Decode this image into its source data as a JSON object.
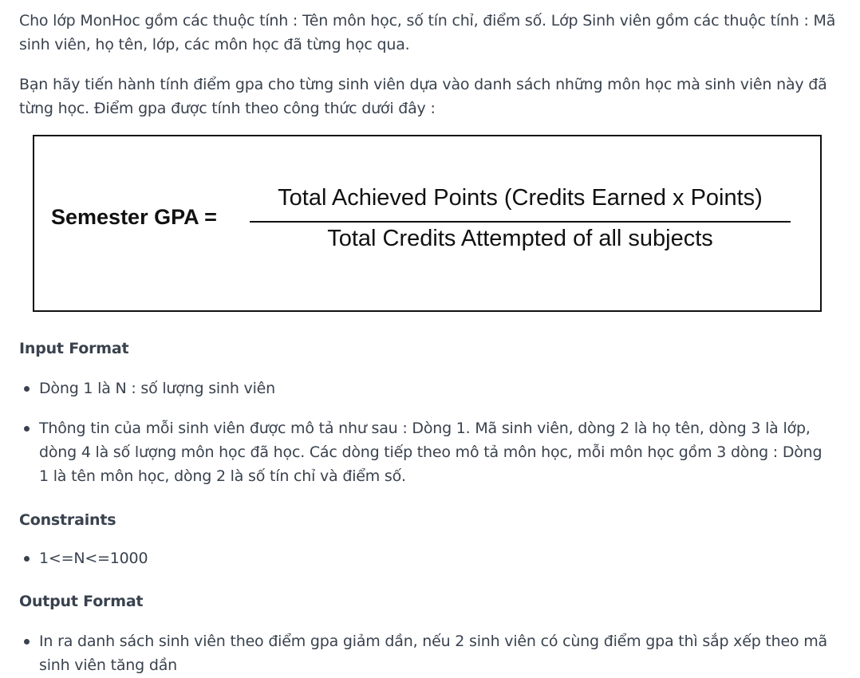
{
  "intro": {
    "paragraph1": "Cho lớp MonHoc gồm các thuộc tính : Tên môn học, số tín chỉ, điểm số. Lớp Sinh viên gồm các thuộc tính : Mã sinh viên, họ tên, lớp, các môn học đã từng học qua.",
    "paragraph2": "Bạn hãy tiến hành tính điểm gpa cho từng sinh viên dựa vào danh sách những môn học mà sinh viên này đã từng học. Điểm gpa được tính theo công thức dưới đây :"
  },
  "formula": {
    "lhs": "Semester GPA =",
    "numerator": "Total Achieved Points (Credits Earned x Points)",
    "denominator": "Total Credits Attempted of all subjects"
  },
  "input_format": {
    "heading": "Input Format",
    "items": [
      "Dòng 1 là N : số lượng sinh viên",
      "Thông tin của mỗi sinh viên được mô tả như sau : Dòng 1. Mã sinh viên, dòng 2 là họ tên, dòng 3 là lớp, dòng 4 là số lượng môn học đã học. Các dòng tiếp theo mô tả môn học, mỗi môn học gồm 3 dòng : Dòng 1 là tên môn học, dòng 2 là số tín chỉ và điểm số."
    ]
  },
  "constraints": {
    "heading": "Constraints",
    "items": [
      "1<=N<=1000"
    ]
  },
  "output_format": {
    "heading": "Output Format",
    "items": [
      "In ra danh sách sinh viên theo điểm gpa giảm dần, nếu 2 sinh viên có cùng điểm gpa thì sắp xếp theo mã sinh viên tăng dần"
    ]
  }
}
